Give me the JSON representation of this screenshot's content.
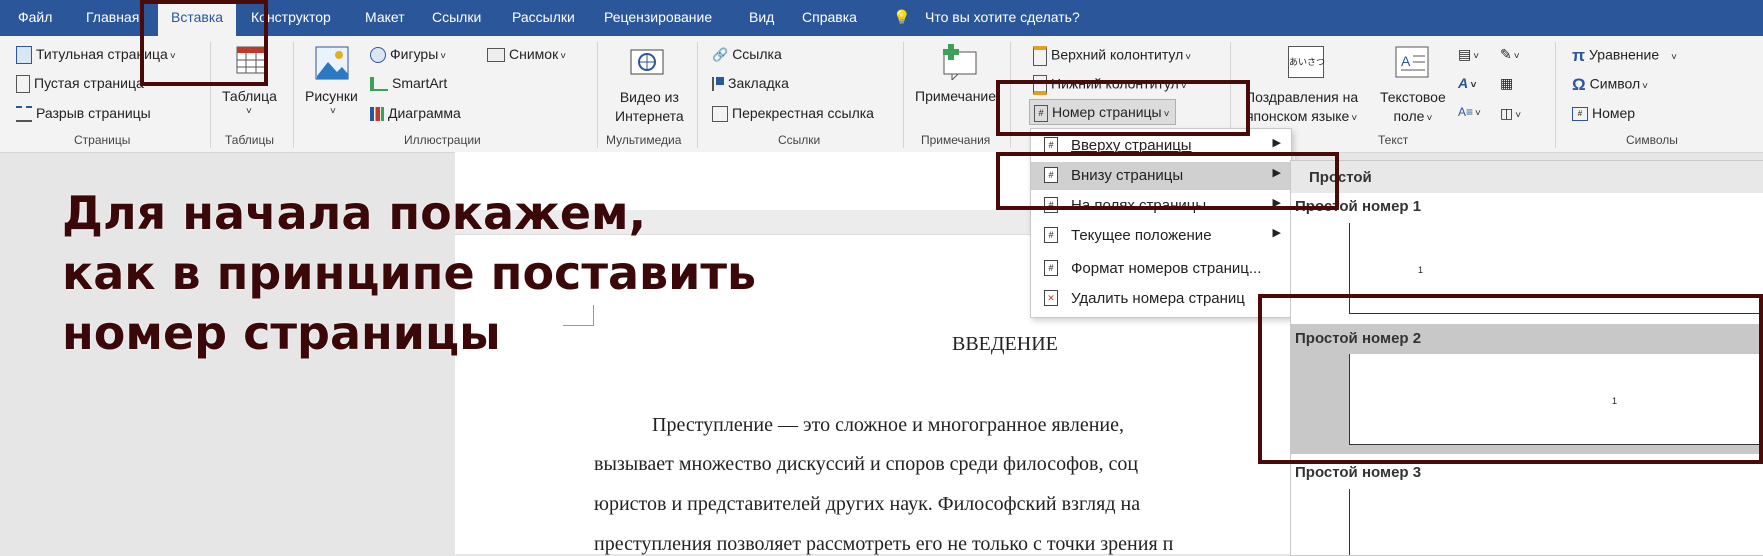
{
  "tabs": [
    "Файл",
    "Главная",
    "Вставка",
    "Конструктор",
    "Макет",
    "Ссылки",
    "Рассылки",
    "Рецензирование",
    "Вид",
    "Справка"
  ],
  "tell_me": "Что вы хотите сделать?",
  "ribbon": {
    "pages": {
      "cover": "Титульная страница",
      "blank": "Пустая страница",
      "break": "Разрыв страницы",
      "group": "Страницы"
    },
    "tables": {
      "table": "Таблица",
      "group": "Таблицы"
    },
    "illustrations": {
      "pictures": "Рисунки",
      "shapes": "Фигуры",
      "smartart": "SmartArt",
      "chart": "Диаграмма",
      "screenshot": "Снимок",
      "group": "Иллюстрации"
    },
    "media": {
      "video_line1": "Видео из",
      "video_line2": "Интернета",
      "group": "Мультимедиа"
    },
    "links": {
      "link": "Ссылка",
      "bookmark": "Закладка",
      "crossref": "Перекрестная ссылка",
      "group": "Ссылки"
    },
    "comments": {
      "comment": "Примечание",
      "group": "Примечания"
    },
    "header_footer": {
      "header": "Верхний колонтитул",
      "footer": "Нижний колонтитул",
      "page_number": "Номер страницы"
    },
    "text": {
      "greeting_line1": "Поздравления на",
      "greeting_line2": "японском языке",
      "greeting_icon": "あいさつ",
      "textbox_line1": "Текстовое",
      "textbox_line2": "поле",
      "group": "Текст"
    },
    "symbols": {
      "equation": "Уравнение",
      "symbol": "Символ",
      "number": "Номер",
      "group": "Символы"
    }
  },
  "caption_lines": [
    "Для начала покажем,",
    "как в принципе поставить",
    "номер страницы"
  ],
  "document": {
    "heading": "ВВЕДЕНИЕ",
    "lines": [
      "Преступление — это сложное и многогранное явление,",
      "вызывает множество дискуссий и споров среди философов, соц",
      "юристов и представителей других наук. Философский взгляд на",
      "преступления позволяет рассмотреть его не только с точки зрения п"
    ]
  },
  "page_number_menu": {
    "items": [
      {
        "label": "Вверху страницы",
        "submenu": true
      },
      {
        "label": "Внизу страницы",
        "submenu": true
      },
      {
        "label": "На полях страницы",
        "submenu": true
      },
      {
        "label": "Текущее положение",
        "submenu": true
      },
      {
        "label": "Формат номеров страниц...",
        "submenu": false
      },
      {
        "label": "Удалить номера страниц",
        "submenu": false
      }
    ]
  },
  "bottom_submenu": {
    "header": "Простой",
    "options": [
      "Простой номер 1",
      "Простой номер 2",
      "Простой номер 3"
    ],
    "preview_number": "1"
  },
  "colors": {
    "tabbar": "#2b579a",
    "ribbon": "#f3f3f3",
    "highlight_box": "#4a0a0a",
    "caption_text": "#3a0808"
  }
}
